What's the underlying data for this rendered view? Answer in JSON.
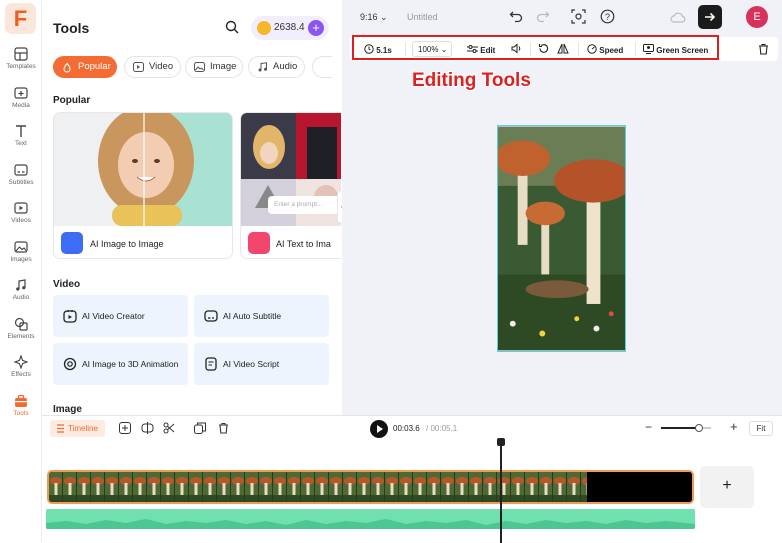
{
  "sidebar": {
    "logo": "F",
    "items": [
      {
        "label": "Templates",
        "icon": "templates-icon"
      },
      {
        "label": "Media",
        "icon": "media-icon"
      },
      {
        "label": "Text",
        "icon": "text-icon"
      },
      {
        "label": "Subtitles",
        "icon": "subtitles-icon"
      },
      {
        "label": "Videos",
        "icon": "videos-icon"
      },
      {
        "label": "Images",
        "icon": "images-icon"
      },
      {
        "label": "Audio",
        "icon": "audio-icon"
      },
      {
        "label": "Elements",
        "icon": "elements-icon"
      },
      {
        "label": "Effects",
        "icon": "effects-icon"
      },
      {
        "label": "Tools",
        "icon": "tools-icon",
        "active": true
      }
    ]
  },
  "panel": {
    "title": "Tools",
    "credits": "2638.4",
    "tabs": [
      "Popular",
      "Video",
      "Image",
      "Audio"
    ],
    "sections": {
      "popular": "Popular",
      "video": "Video",
      "image": "Image"
    },
    "cards": [
      "AI Image to Image",
      "AI Text to Ima"
    ],
    "prompt_placeholder": "Enter a prompt...",
    "video_tools": [
      "AI Video Creator",
      "AI Auto Subtitle",
      "AI Image to 3D Animation",
      "AI Video Script"
    ]
  },
  "editor": {
    "ratio": "9:16",
    "project_title": "Untitled",
    "avatar": "E",
    "toolbar": {
      "duration": "5.1s",
      "zoom": "100%",
      "edit": "Edit",
      "speed": "Speed",
      "green_screen": "Green Screen"
    },
    "annotation": "Editing Tools"
  },
  "timeline": {
    "label": "Timeline",
    "current_time": "00:03.6",
    "total_time": "/ 00:05.1",
    "fit": "Fit",
    "add": "+",
    "zoom_level": 0.75
  },
  "colors": {
    "accent": "#f46c33",
    "highlight": "#e02020",
    "audio": "#6fe0ae",
    "purple": "#8b55f6"
  }
}
